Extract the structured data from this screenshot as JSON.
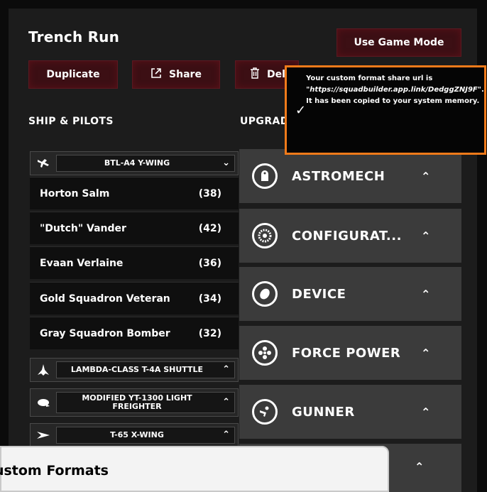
{
  "list": {
    "title": "Trench Run"
  },
  "buttons": {
    "game_mode": "Use Game Mode",
    "duplicate": "Duplicate",
    "share": "Share",
    "delete": "Delete"
  },
  "sections": {
    "ships": "SHIP & PILOTS",
    "upgrades": "UPGRADE TYPES"
  },
  "ships": [
    {
      "name": "BTL-A4 Y-WING",
      "expanded": true
    },
    {
      "name": "LAMBDA-CLASS T-4A SHUTTLE",
      "expanded": false
    },
    {
      "name": "MODIFIED YT-1300 LIGHT FREIGHTER",
      "expanded": false
    },
    {
      "name": "T-65 X-WING",
      "expanded": false
    }
  ],
  "pilots": [
    {
      "name": "Horton Salm",
      "cost": "(38)"
    },
    {
      "name": "\"Dutch\" Vander",
      "cost": "(42)"
    },
    {
      "name": "Evaan Verlaine",
      "cost": "(36)"
    },
    {
      "name": "Gold Squadron Veteran",
      "cost": "(34)"
    },
    {
      "name": "Gray Squadron Bomber",
      "cost": "(32)"
    }
  ],
  "upgrades": [
    {
      "label": "ASTROMECH",
      "icon": "astromech-icon"
    },
    {
      "label": "CONFIGURAT...",
      "icon": "configuration-icon"
    },
    {
      "label": "DEVICE",
      "icon": "device-icon"
    },
    {
      "label": "FORCE POWER",
      "icon": "force-power-icon"
    },
    {
      "label": "GUNNER",
      "icon": "gunner-icon"
    }
  ],
  "toast": {
    "prefix": "Your custom format share url is",
    "url": "\"https://squadbuilder.app.link/DedggZNJ9F\"",
    "suffix": ". It has been copied to your system memory.",
    "accent": "#f07a1a"
  },
  "custom_formats": {
    "label": "Custom Formats"
  },
  "colors": {
    "button_bg": "#3c0f14",
    "panel_bg": "#1c1c1c",
    "upgrade_bg": "#3b3b3b"
  }
}
